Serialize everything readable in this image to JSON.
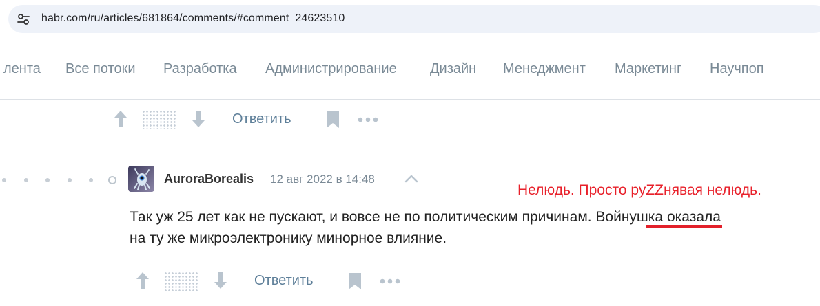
{
  "browser": {
    "url": "habr.com/ru/articles/681864/comments/#comment_24623510",
    "site_icon": "site-settings-icon"
  },
  "nav": {
    "items": [
      "лента",
      "Все потоки",
      "Разработка",
      "Администрирование",
      "Дизайн",
      "Менеджмент",
      "Маркетинг",
      "Научпоп"
    ]
  },
  "actions_top": {
    "reply_label": "Ответить"
  },
  "comment": {
    "author": "AuroraBorealis",
    "timestamp": "12 авг 2022 в 14:48",
    "text_line1": "Так уж 25 лет как не пускают, и вовсе не по политическим причинам. Войнушка оказала",
    "text_line2": "на ту же микроэлектронику минорное влияние.",
    "reply_label": "Ответить"
  },
  "annotation": {
    "text": "Нелюдь. Просто руZZнявая нелюдь.",
    "color": "#e8202a"
  },
  "colors": {
    "nav_text": "#7a8a96",
    "link": "#5e7f99",
    "icon_gray": "#b9c4ce"
  }
}
